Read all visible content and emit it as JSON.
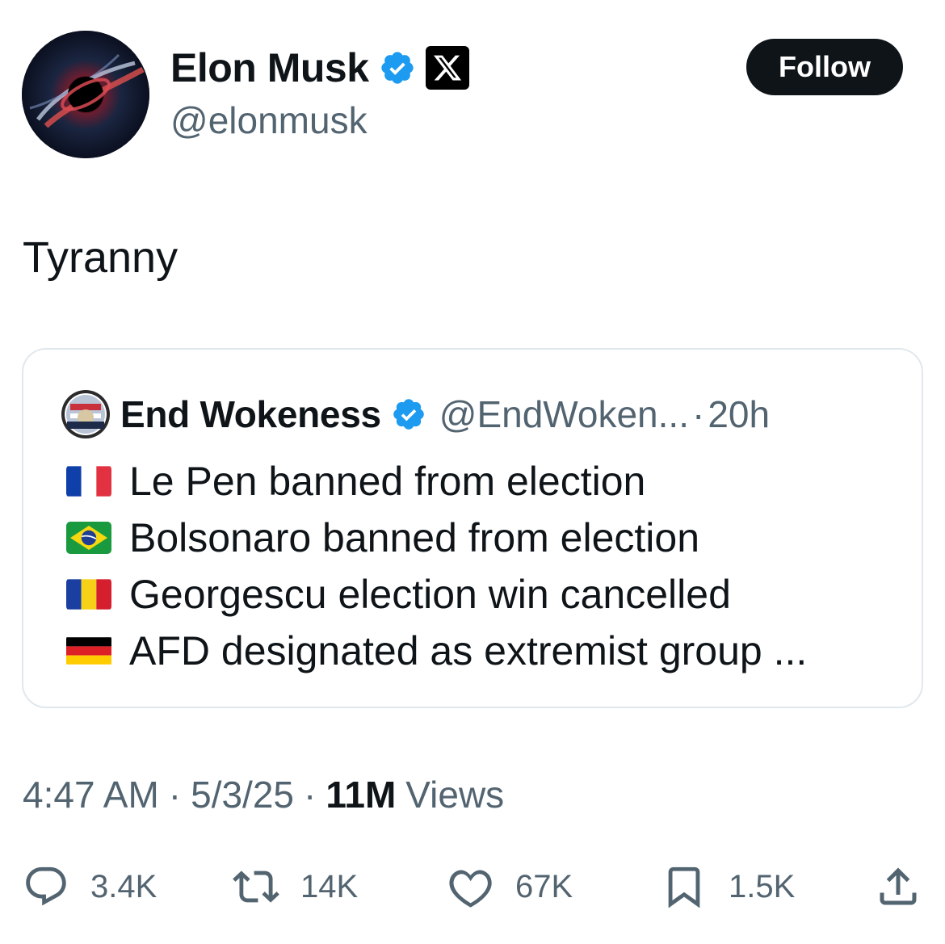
{
  "author": {
    "display_name": "Elon Musk",
    "handle": "@elonmusk",
    "verified": true,
    "affiliate_badge": "x-logo-icon"
  },
  "follow_label": "Follow",
  "tweet_text": "Tyranny",
  "quoted_tweet": {
    "display_name": "End Wokeness",
    "handle": "@EndWoken...",
    "separator": "·",
    "time": "20h",
    "lines": [
      {
        "flag": "france",
        "text": "Le Pen banned from election"
      },
      {
        "flag": "brazil",
        "text": "Bolsonaro banned from election"
      },
      {
        "flag": "romania",
        "text": "Georgescu election win cancelled"
      },
      {
        "flag": "germany",
        "text": "AFD designated as extremist group ..."
      }
    ]
  },
  "meta": {
    "time": "4:47 AM",
    "sep": "·",
    "date": "5/3/25",
    "views_count": "11M",
    "views_label": "Views"
  },
  "actions": {
    "replies": "3.4K",
    "reposts": "14K",
    "likes": "67K",
    "bookmarks": "1.5K"
  },
  "colors": {
    "text_primary": "#0f1419",
    "text_secondary": "#536471",
    "verified_blue": "#1d9bf0",
    "card_border": "#e1e8ed"
  }
}
